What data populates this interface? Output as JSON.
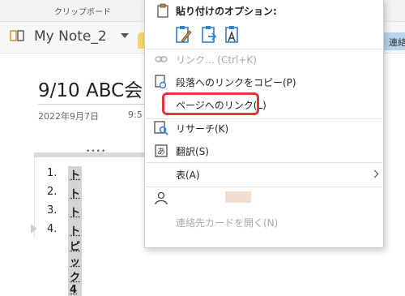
{
  "ribbon": {
    "clipboard_label": "クリップボード"
  },
  "notebook": {
    "name": "My Note_2",
    "partial_tab": "連絡"
  },
  "page": {
    "title": "9/10 ABC会",
    "date": "2022年9月7日",
    "time": "9:5"
  },
  "outline": {
    "handle": "••••",
    "items": [
      {
        "num": "1.",
        "text": "トピック1"
      },
      {
        "num": "2.",
        "text": "トピック2"
      },
      {
        "num": "3.",
        "text": "トピック3"
      },
      {
        "num": "4.",
        "text": "トピック4"
      }
    ]
  },
  "menu": {
    "header": "貼り付けのオプション:",
    "items": [
      {
        "label": "リンク... (Ctrl+K)",
        "disabled": true
      },
      {
        "label": "段落へのリンクをコピー(P)"
      },
      {
        "label": "ページへのリンク(L)"
      },
      {
        "label": "リサーチ(K)"
      },
      {
        "label": "翻訳(S)"
      },
      {
        "label": "表(A)"
      },
      {
        "label": ""
      },
      {
        "label": "連絡先カードを開く(N)",
        "disabled": true
      }
    ]
  },
  "colors": {
    "highlight": "#e53342",
    "paste_icon": "#2f7fd6",
    "disabled_text": "#a9a9a9"
  }
}
